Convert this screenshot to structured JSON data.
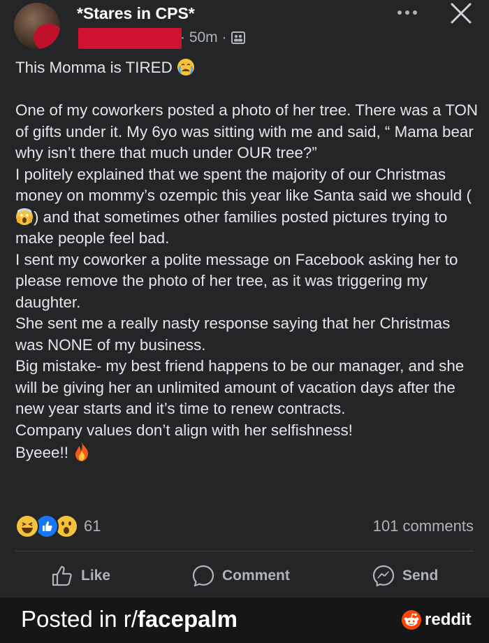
{
  "header": {
    "group_name": "*Stares in CPS*",
    "time": "· 50m ·",
    "privacy_icon": "group-icon",
    "more_icon": "more-dots-icon",
    "close_icon": "close-icon"
  },
  "post": {
    "title_line": "This Momma is TIRED",
    "title_emoji": "crying-face-emoji",
    "paragraph1": "One of my coworkers posted a photo of her tree. There was a TON of gifts under it. My 6yo was sitting with me and said, “ Mama bear why isn’t there that much under OUR tree?”",
    "paragraph2_part1": "I politely explained that we spent the majority of our Christmas money on mommy’s ozempic this year like Santa said we should (",
    "paragraph2_emoji": "screaming-face-emoji",
    "paragraph2_part2": ") and that sometimes other families posted pictures trying to make people feel bad.",
    "paragraph3": "I sent my coworker a polite message on Facebook asking her to please remove the photo of her tree, as it was triggering my daughter.",
    "paragraph4": "She sent me a really nasty response saying that her Christmas was NONE of my business.",
    "paragraph5": "Big mistake- my best friend happens to be our manager, and she will be giving her an unlimited amount of vacation days after the new year starts and it’s time to renew contracts.",
    "paragraph6": "Company values don’t align with her selfishness!",
    "paragraph7": "Byeee!!",
    "paragraph7_emoji": "fire-emoji"
  },
  "stats": {
    "reactions": [
      "haha-reaction-icon",
      "like-reaction-icon",
      "wow-reaction-icon"
    ],
    "reaction_count": "61",
    "comments": "101 comments"
  },
  "actions": {
    "like": "Like",
    "comment": "Comment",
    "send": "Send"
  },
  "footer": {
    "prefix": "Posted in r/",
    "subreddit": "facepalm",
    "brand": "reddit"
  },
  "colors": {
    "background": "#242526",
    "text": "#e4e6eb",
    "muted": "#b0b3b8",
    "like_blue": "#1877f2",
    "redaction": "#d1122e",
    "reddit_orange": "#ff4500"
  }
}
